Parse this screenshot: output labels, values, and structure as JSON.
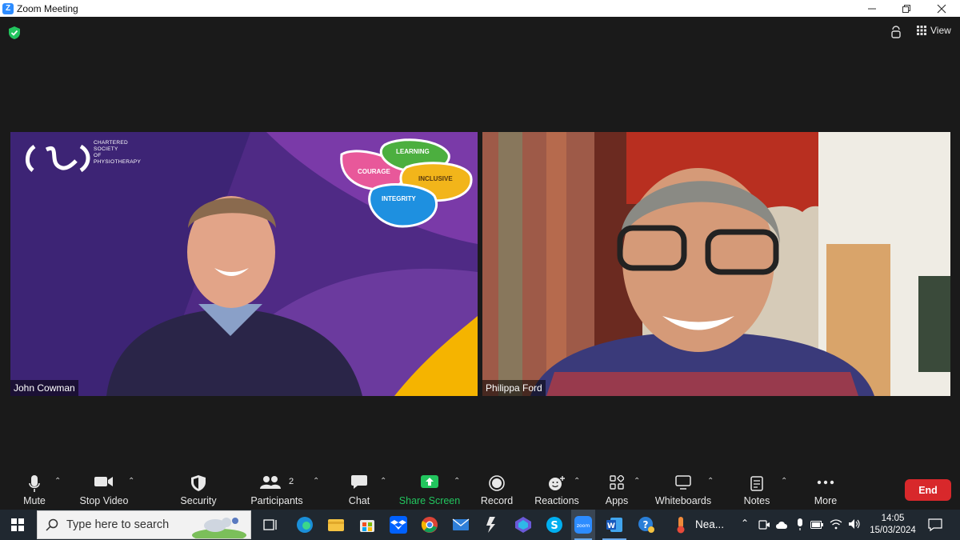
{
  "window": {
    "title": "Zoom Meeting",
    "app_icon": "Z"
  },
  "topbar": {
    "view_label": "View"
  },
  "participants": [
    {
      "name": "John Cowman"
    },
    {
      "name": "Philippa Ford"
    }
  ],
  "background": {
    "org_lines": [
      "CHARTERED",
      "SOCIETY",
      "OF",
      "PHYSIOTHERAPY"
    ],
    "values": [
      "LEARNING",
      "COURAGE",
      "INCLUSIVE",
      "INTEGRITY"
    ]
  },
  "toolbar": {
    "mute": "Mute",
    "stop_video": "Stop Video",
    "security": "Security",
    "participants": "Participants",
    "participants_count": "2",
    "chat": "Chat",
    "share_screen": "Share Screen",
    "record": "Record",
    "reactions": "Reactions",
    "apps": "Apps",
    "whiteboards": "Whiteboards",
    "notes": "Notes",
    "more": "More",
    "end": "End"
  },
  "taskbar": {
    "search_placeholder": "Type here to search",
    "weather_label": "Nea...",
    "time": "14:05",
    "date": "15/03/2024"
  },
  "colors": {
    "accent": "#2d8cff",
    "end": "#d8282b",
    "share": "#22c55e",
    "taskbar": "#202830"
  }
}
